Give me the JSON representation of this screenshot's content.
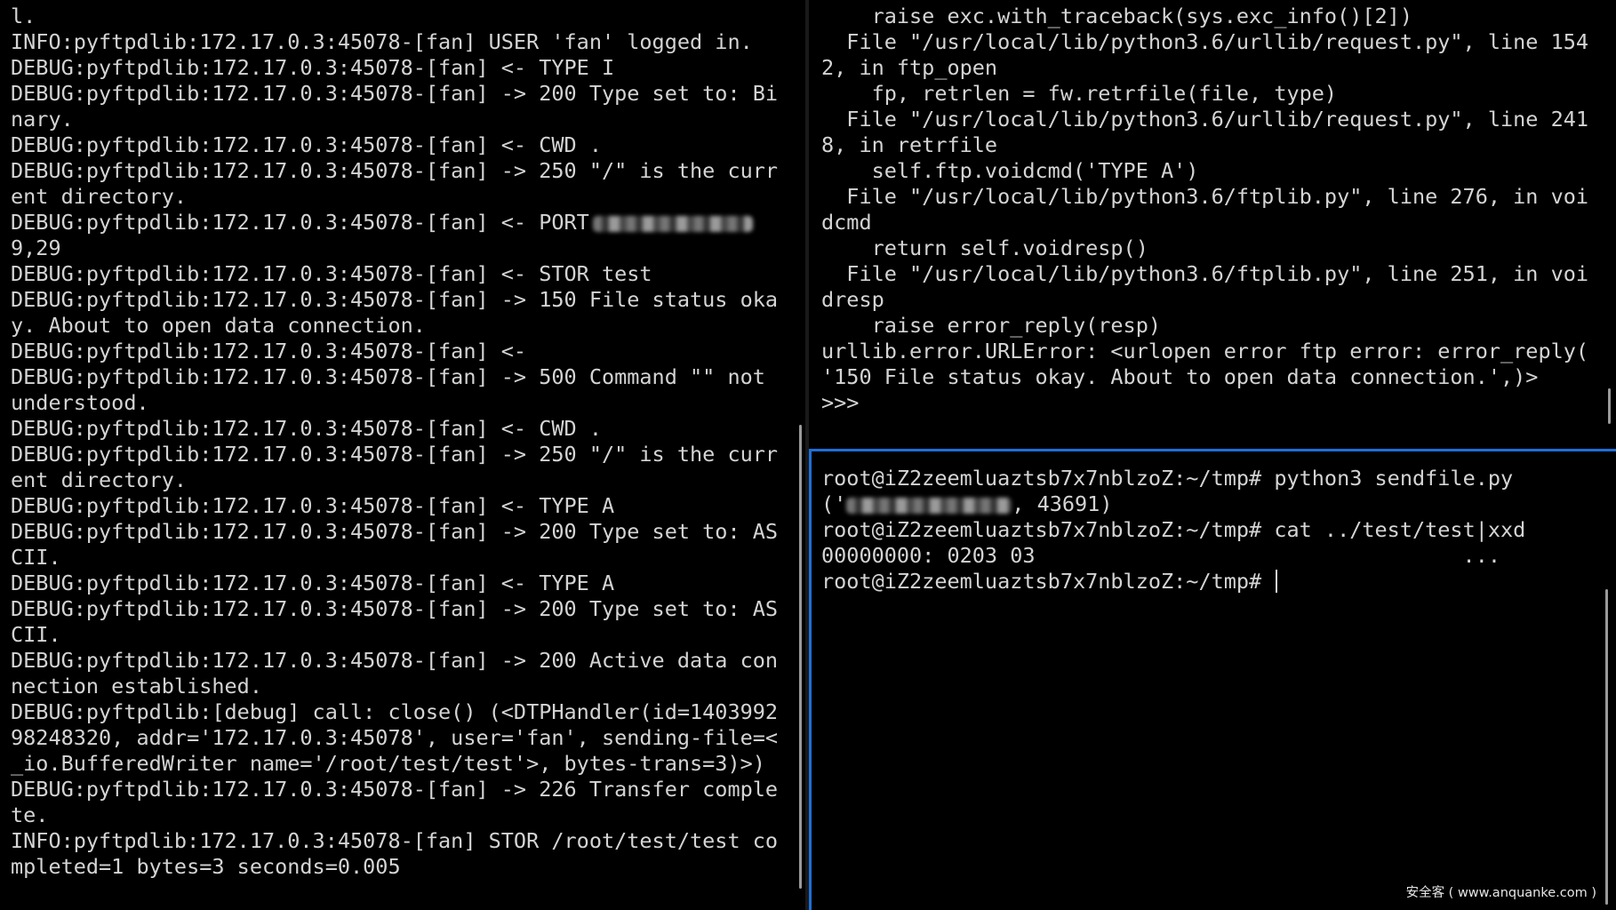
{
  "left_pane": {
    "lines": [
      "l.",
      "INFO:pyftpdlib:172.17.0.3:45078-[fan] USER 'fan' logged in.",
      "DEBUG:pyftpdlib:172.17.0.3:45078-[fan] <- TYPE I",
      "DEBUG:pyftpdlib:172.17.0.3:45078-[fan] -> 200 Type set to: Bi",
      "nary.",
      "DEBUG:pyftpdlib:172.17.0.3:45078-[fan] <- CWD .",
      "DEBUG:pyftpdlib:172.17.0.3:45078-[fan] -> 250 \"/\" is the curr",
      "ent directory.",
      "DEBUG:pyftpdlib:172.17.0.3:45078-[fan] <- PORT",
      "9,29",
      "DEBUG:pyftpdlib:172.17.0.3:45078-[fan] <- STOR test",
      "DEBUG:pyftpdlib:172.17.0.3:45078-[fan] -> 150 File status oka",
      "y. About to open data connection.",
      "DEBUG:pyftpdlib:172.17.0.3:45078-[fan] <-",
      "DEBUG:pyftpdlib:172.17.0.3:45078-[fan] -> 500 Command \"\" not",
      "understood.",
      "DEBUG:pyftpdlib:172.17.0.3:45078-[fan] <- CWD .",
      "DEBUG:pyftpdlib:172.17.0.3:45078-[fan] -> 250 \"/\" is the curr",
      "ent directory.",
      "DEBUG:pyftpdlib:172.17.0.3:45078-[fan] <- TYPE A",
      "DEBUG:pyftpdlib:172.17.0.3:45078-[fan] -> 200 Type set to: AS",
      "CII.",
      "DEBUG:pyftpdlib:172.17.0.3:45078-[fan] <- TYPE A",
      "DEBUG:pyftpdlib:172.17.0.3:45078-[fan] -> 200 Type set to: AS",
      "CII.",
      "DEBUG:pyftpdlib:172.17.0.3:45078-[fan] -> 200 Active data con",
      "nection established.",
      "DEBUG:pyftpdlib:[debug] call: close() (<DTPHandler(id=1403992",
      "98248320, addr='172.17.0.3:45078', user='fan', sending-file=<",
      "_io.BufferedWriter name='/root/test/test'>, bytes-trans=3)>)",
      "DEBUG:pyftpdlib:172.17.0.3:45078-[fan] -> 226 Transfer comple",
      "te.",
      "INFO:pyftpdlib:172.17.0.3:45078-[fan] STOR /root/test/test co",
      "mpleted=1 bytes=3 seconds=0.005"
    ]
  },
  "right_top_pane": {
    "lines": [
      "    raise exc.with_traceback(sys.exc_info()[2])",
      "  File \"/usr/local/lib/python3.6/urllib/request.py\", line 154",
      "2, in ftp_open",
      "    fp, retrlen = fw.retrfile(file, type)",
      "  File \"/usr/local/lib/python3.6/urllib/request.py\", line 241",
      "8, in retrfile",
      "    self.ftp.voidcmd('TYPE A')",
      "  File \"/usr/local/lib/python3.6/ftplib.py\", line 276, in voi",
      "dcmd",
      "    return self.voidresp()",
      "  File \"/usr/local/lib/python3.6/ftplib.py\", line 251, in voi",
      "dresp",
      "    raise error_reply(resp)",
      "urllib.error.URLError: <urlopen error ftp error: error_reply(",
      "'150 File status okay. About to open data connection.',)>",
      ">>>"
    ]
  },
  "right_bottom_pane": {
    "prompt": "root@iZ2zeemluaztsb7x7nblzoZ:~/tmp# ",
    "command_1": "python3 sendfile.py",
    "output_1_prefix": "('",
    "output_1_suffix": ", 43691)",
    "command_2": "cat ../test/test|xxd",
    "output_2": "00000000: 0203 03                                  ..."
  },
  "watermark": "安全客 ( www.anquanke.com )"
}
